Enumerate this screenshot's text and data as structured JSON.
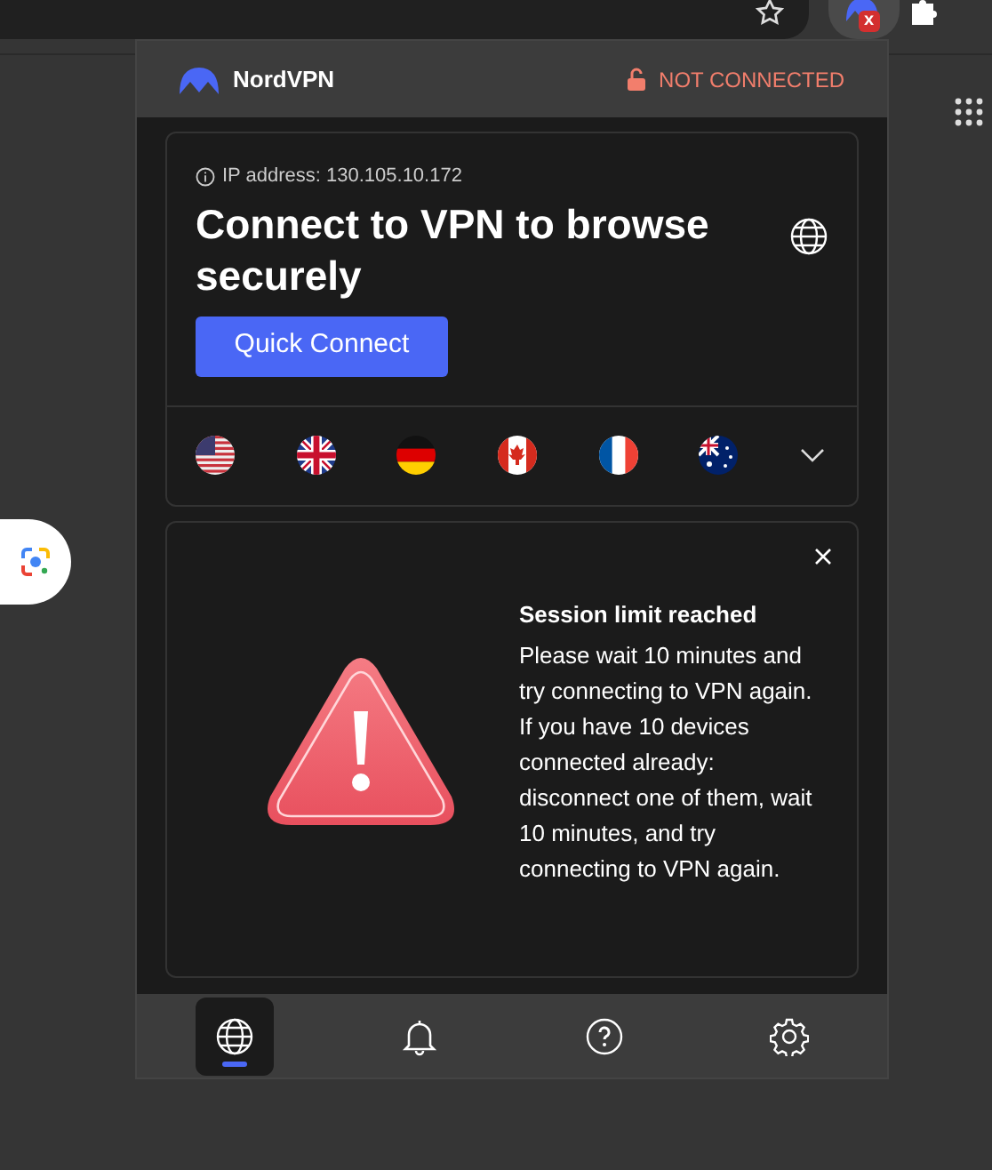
{
  "toolbar": {
    "extension_badge": "x"
  },
  "popup": {
    "brand": "NordVPN",
    "status": "NOT CONNECTED",
    "ip_address": "IP address: 130.105.10.172",
    "heading": "Connect to VPN to browse securely",
    "quick_connect": "Quick Connect",
    "alert": {
      "title": "Session limit reached",
      "message": "Please wait 10 minutes and try connecting to VPN again. If you have 10 devices connected already: disconnect one of them, wait 10 minutes, and try connecting to VPN again."
    },
    "nav": [
      {
        "kind": "globe",
        "selected": true
      },
      {
        "kind": "bell",
        "selected": false
      },
      {
        "kind": "help",
        "selected": false
      },
      {
        "kind": "settings",
        "selected": false
      }
    ]
  }
}
